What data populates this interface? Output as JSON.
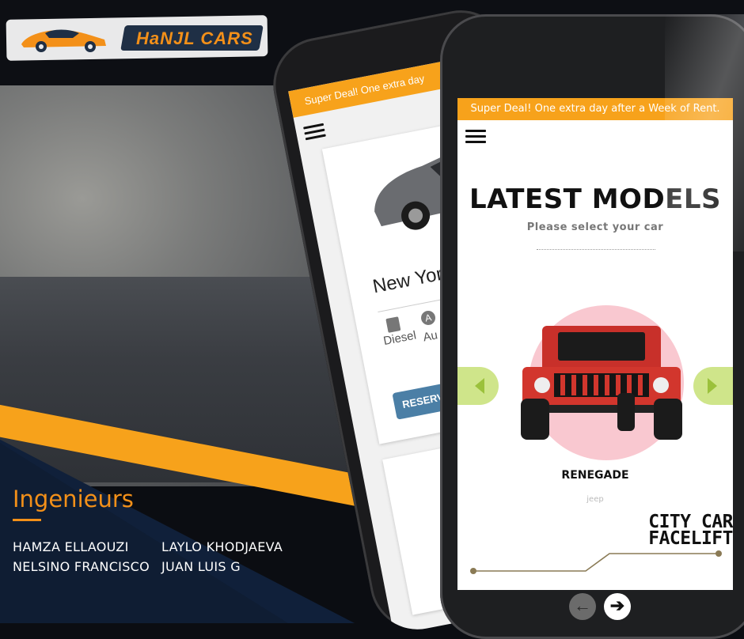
{
  "brand": {
    "logo_text": "HaNJL CARS",
    "accent_color": "#f39019",
    "navy_color": "#0f1d33"
  },
  "engineers": {
    "title": "Ingenieurs",
    "names": [
      "HAMZA ELLAOUZI",
      "LAYLO KHODJAEVA",
      "NELSINO FRANCISCO",
      "JUAN LUIS G"
    ]
  },
  "back_phone": {
    "banner": "Super Deal! One extra day",
    "menu_icon": "hamburger-icon",
    "card_title": "New Yor",
    "fuel_label": "Diesel",
    "transmission_icon_letter": "A",
    "transmission_label": "Au",
    "reserve_button": "RESERVA"
  },
  "front_phone": {
    "banner": "Super Deal! One extra day after a Week of Rent.",
    "menu_icon": "hamburger-icon",
    "section_title": "LATEST MODELS",
    "section_subtitle": "Please select your car",
    "carousel": {
      "prev_icon": "triangle-left-icon",
      "next_icon": "triangle-right-icon",
      "model_name": "RENEGADE",
      "model_brand": "jeep"
    },
    "promo_line1": "CITY CAR",
    "promo_line2": "FACELIFT"
  },
  "pager": {
    "prev_glyph": "←",
    "next_glyph": "➔"
  }
}
